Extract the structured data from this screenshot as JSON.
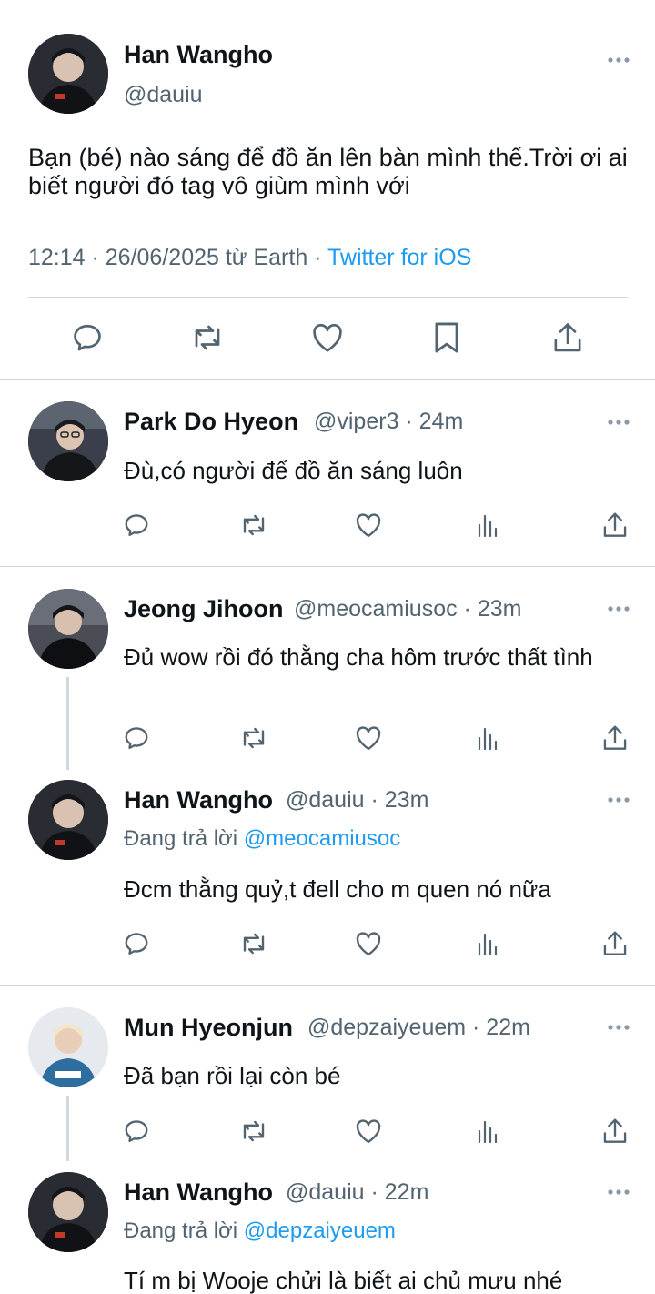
{
  "main_tweet": {
    "name": "Han Wangho",
    "handle": "@dauiu",
    "text": "Bạn (bé) nào sáng để đồ ăn lên bàn mình thế.Trời ơi ai biết người đó tag vô giùm mình với",
    "meta_time": "12:14 · 26/06/2025 từ Earth · ",
    "source": "Twitter for iOS"
  },
  "replies": [
    {
      "name": "Park Do Hyeon",
      "handle_time": "@viper3 · 24m",
      "text": "Đù,có người để đồ ăn sáng luôn"
    },
    {
      "name": "Jeong Jihoon",
      "handle_time": "@meocamiusoc · 23m",
      "text": "Đủ wow rồi đó thằng cha hôm trước thất tình"
    },
    {
      "name": "Han Wangho",
      "handle_time": "@dauiu · 23m",
      "reply_prefix": "Đang trả lời ",
      "reply_to": "@meocamiusoc",
      "text": "Đcm thằng quỷ,t đell cho m quen nó nữa"
    },
    {
      "name": "Mun Hyeonjun",
      "handle_time": "@depzaiyeuem · 22m",
      "text": "Đã bạn rồi lại còn bé"
    },
    {
      "name": "Han Wangho",
      "handle_time": "@dauiu · 22m",
      "reply_prefix": "Đang trả lời ",
      "reply_to": "@depzaiyeuem",
      "text": "Tí m bị Wooje chửi là biết ai chủ mưu nhé"
    }
  ],
  "colors": {
    "link": "#1d9bf0",
    "secondary_text": "#536471",
    "divider": "#cfd9de"
  },
  "icons": [
    "reply-icon",
    "retweet-icon",
    "like-icon",
    "bookmark-icon",
    "share-icon",
    "views-icon",
    "more-icon"
  ]
}
